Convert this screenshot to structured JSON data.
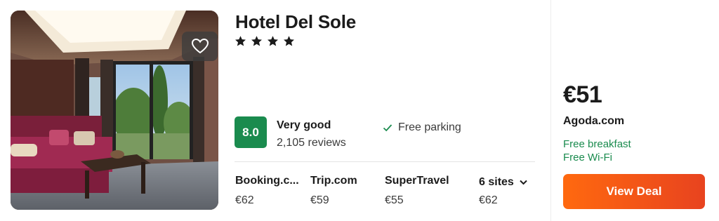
{
  "hotel": {
    "name": "Hotel Del Sole",
    "star_count": 4,
    "favorite_icon": "heart-icon"
  },
  "rating": {
    "score": "8.0",
    "label": "Very good",
    "reviews": "2,105 reviews",
    "color": "#1a8b4e"
  },
  "amenity": {
    "icon": "check-icon",
    "label": "Free parking"
  },
  "sites": [
    {
      "name": "Booking.c...",
      "price": "€62"
    },
    {
      "name": "Trip.com",
      "price": "€59"
    },
    {
      "name": "SuperTravel",
      "price": "€55"
    },
    {
      "name": "6 sites",
      "price": "€62",
      "icon": "chevron-down-icon"
    }
  ],
  "deal": {
    "price": "€51",
    "provider": "Agoda.com",
    "perks": [
      "Free breakfast",
      "Free Wi-Fi"
    ],
    "button_label": "View Deal",
    "button_color": "#ff690f",
    "perk_color": "#1a8b4e"
  }
}
